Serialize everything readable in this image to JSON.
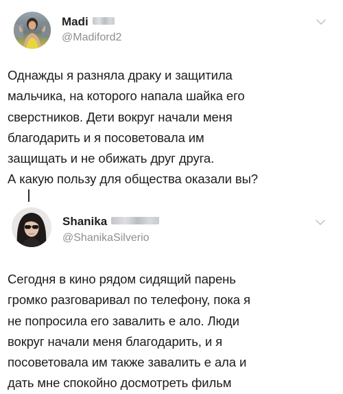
{
  "tweets": [
    {
      "display_name": "Madi",
      "handle": "@Madiford2",
      "text_lines": [
        "Однажды я разняла драку и защитила",
        "мальчика, на которого напала шайка его",
        "сверстников. Дети вокруг начали меня",
        "благодарить и я посоветовала им",
        "защищать и не обижать друг друга.",
        "А какую пользу для общества оказали вы?"
      ]
    },
    {
      "display_name": "Shanika",
      "handle": "@ShanikaSilverio",
      "text_lines": [
        "Сегодня в кино рядом сидящий парень",
        "громко разговаривал по телефону, пока я",
        "не попросила его завалить е  ало. Люди",
        "вокруг начали меня благодарить, и я",
        "посоветовала им также завалить е  ала и",
        "дать мне спокойно досмотреть фильм"
      ]
    }
  ],
  "icons": {
    "menu": "chevron-down-icon",
    "avatar": "profile-photo"
  },
  "colors": {
    "text": "#1c1c1e",
    "name": "#1f1f1f",
    "handle": "#8e8e93",
    "chevron": "#c7c7cc",
    "background": "#ffffff"
  }
}
